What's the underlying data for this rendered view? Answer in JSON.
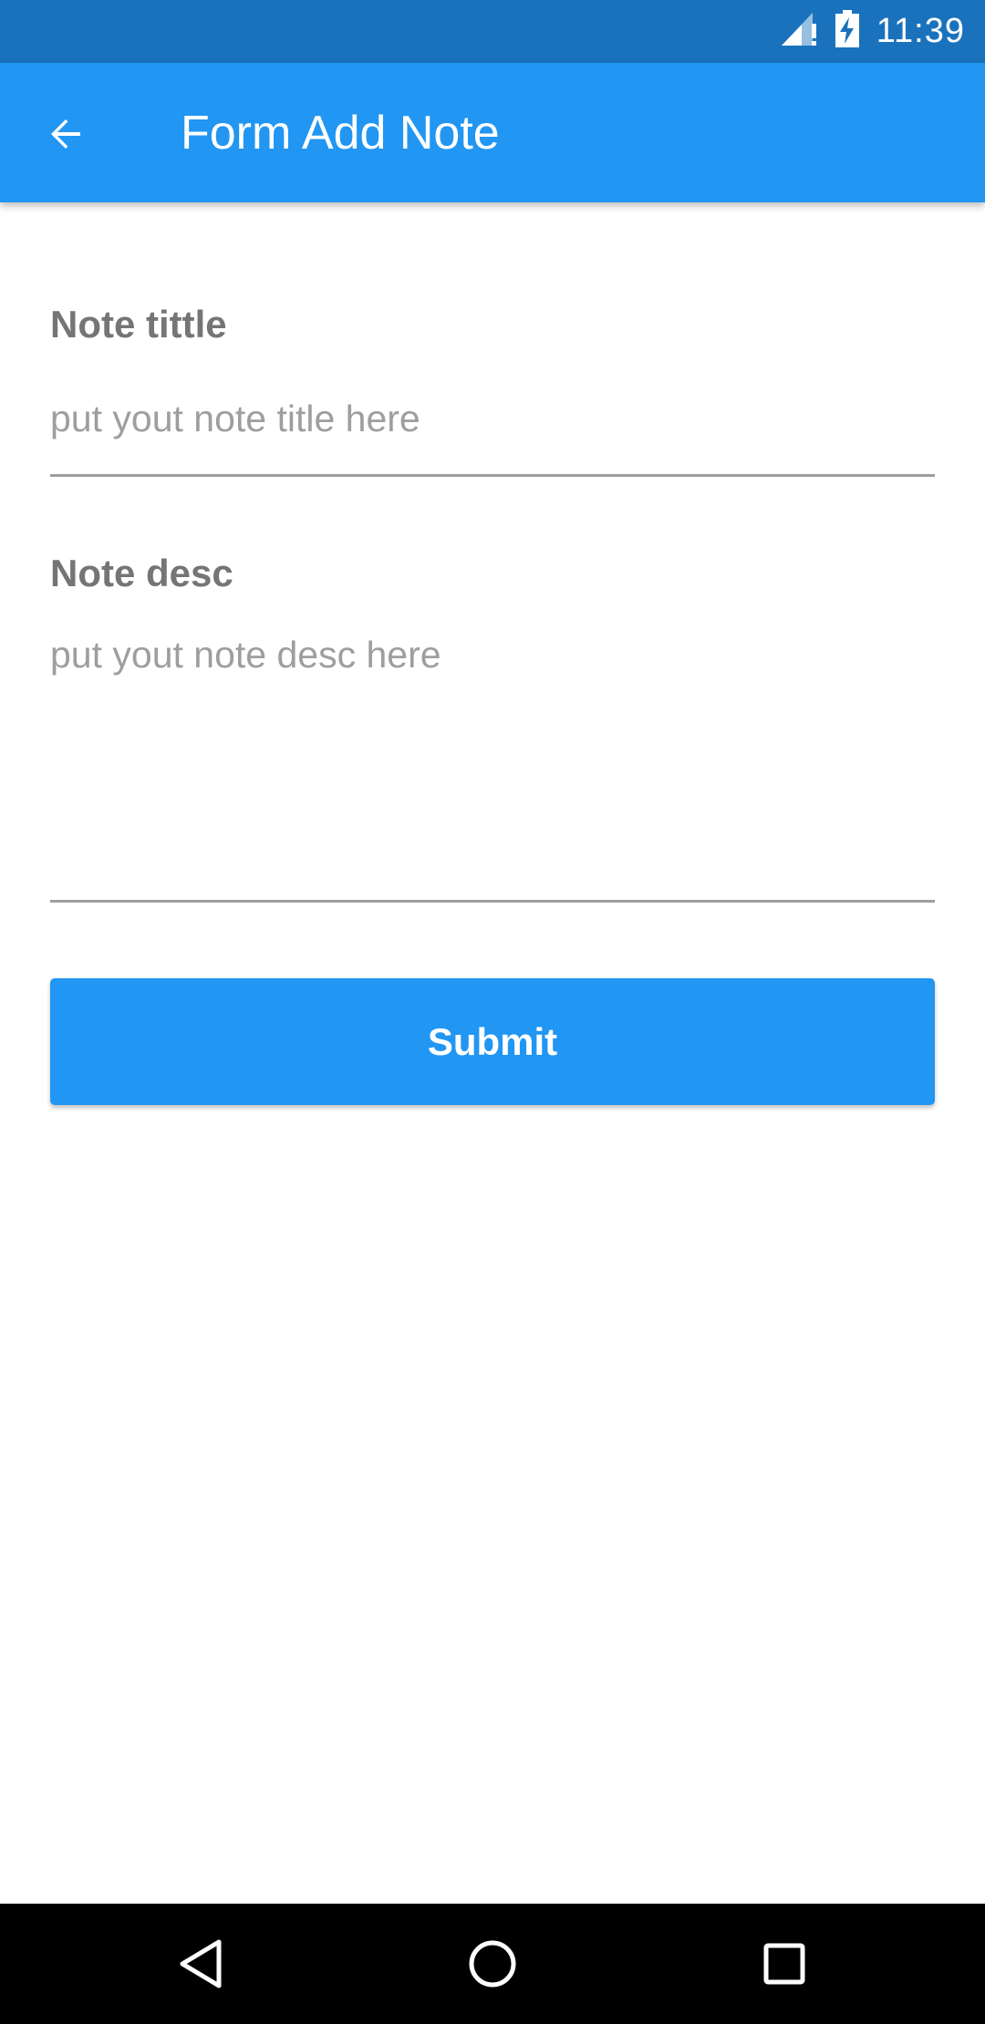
{
  "status_bar": {
    "time": "11:39",
    "icons": [
      "signal-alert-icon",
      "battery-charging-icon"
    ]
  },
  "app_bar": {
    "title": "Form Add Note",
    "back_icon": "arrow-back-icon",
    "color": "#2196f3"
  },
  "form": {
    "title_label": "Note tittle",
    "title_placeholder": "put yout note title here",
    "title_value": "",
    "desc_label": "Note desc",
    "desc_placeholder": "put yout note desc here",
    "desc_value": "",
    "submit_label": "Submit"
  },
  "nav_bar": {
    "icons": [
      "nav-back-icon",
      "nav-home-icon",
      "nav-recents-icon"
    ]
  },
  "colors": {
    "status_bar": "#1a72bd",
    "primary": "#2196f3",
    "label": "#757575",
    "placeholder": "#9e9e9e"
  }
}
